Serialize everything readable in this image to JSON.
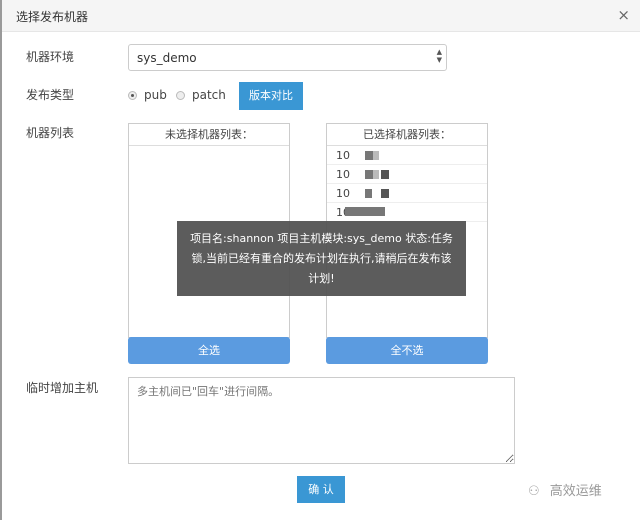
{
  "dialog": {
    "title": "选择发布机器",
    "close_icon": "×"
  },
  "form": {
    "env_label": "机器环境",
    "env_value": "sys_demo",
    "type_label": "发布类型",
    "type_options": [
      {
        "label": "pub",
        "checked": true
      },
      {
        "label": "patch",
        "checked": false
      }
    ],
    "compare_button": "版本对比",
    "machine_list_label": "机器列表",
    "unselected_list": {
      "header": "未选择机器列表：",
      "items": []
    },
    "selected_list": {
      "header": "已选择机器列表：",
      "items": [
        "10",
        "10",
        "10",
        "10"
      ]
    },
    "select_all_button": "全选",
    "deselect_all_button": "全不选",
    "temp_host_label": "临时增加主机",
    "temp_host_placeholder": "多主机间已\"回车\"进行间隔。",
    "confirm_button": "确 认"
  },
  "toast": {
    "message": "项目名:shannon 项目主机模块:sys_demo 状态:任务锁,当前已经有重合的发布计划在执行,请稍后在发布该计划!"
  },
  "watermark": {
    "icon": "wechat-icon",
    "text": "高效运维"
  }
}
